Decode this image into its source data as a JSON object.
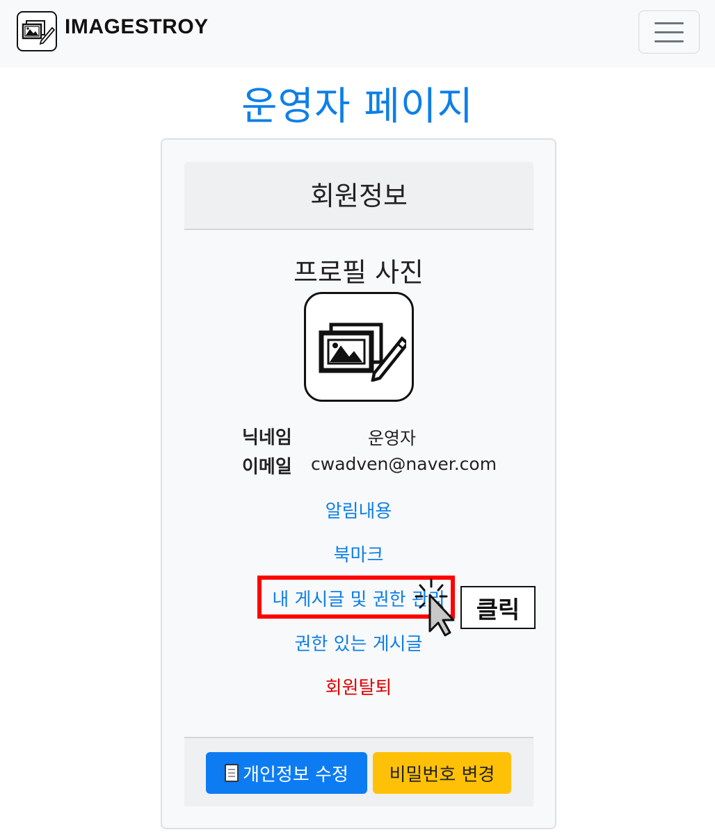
{
  "navbar": {
    "brand": "IMAGESTROY",
    "logo_icon": "image-edit-icon",
    "menu_icon": "hamburger-menu-icon"
  },
  "page": {
    "title": "운영자 페이지"
  },
  "card": {
    "header": "회원정보",
    "profile_title": "프로필 사진",
    "avatar_icon": "image-edit-icon",
    "info": {
      "nickname_label": "닉네임",
      "nickname_value": "운영자",
      "email_label": "이메일",
      "email_value": "cwadven@naver.com"
    },
    "links": {
      "notifications": "알림내용",
      "bookmarks": "북마크",
      "my_posts": "내 게시글 및 권한 관리",
      "permitted_posts": "권한 있는 게시글",
      "withdraw": "회원탈퇴"
    },
    "footer": {
      "edit_profile": "개인정보 수정",
      "change_password": "비밀번호 변경"
    }
  },
  "annotation": {
    "click_label": "클릭"
  },
  "colors": {
    "link": "#0d7fe8",
    "danger": "#e00000",
    "primary": "#0d7cf2",
    "warning": "#ffc107",
    "highlight": "#ff0000"
  }
}
